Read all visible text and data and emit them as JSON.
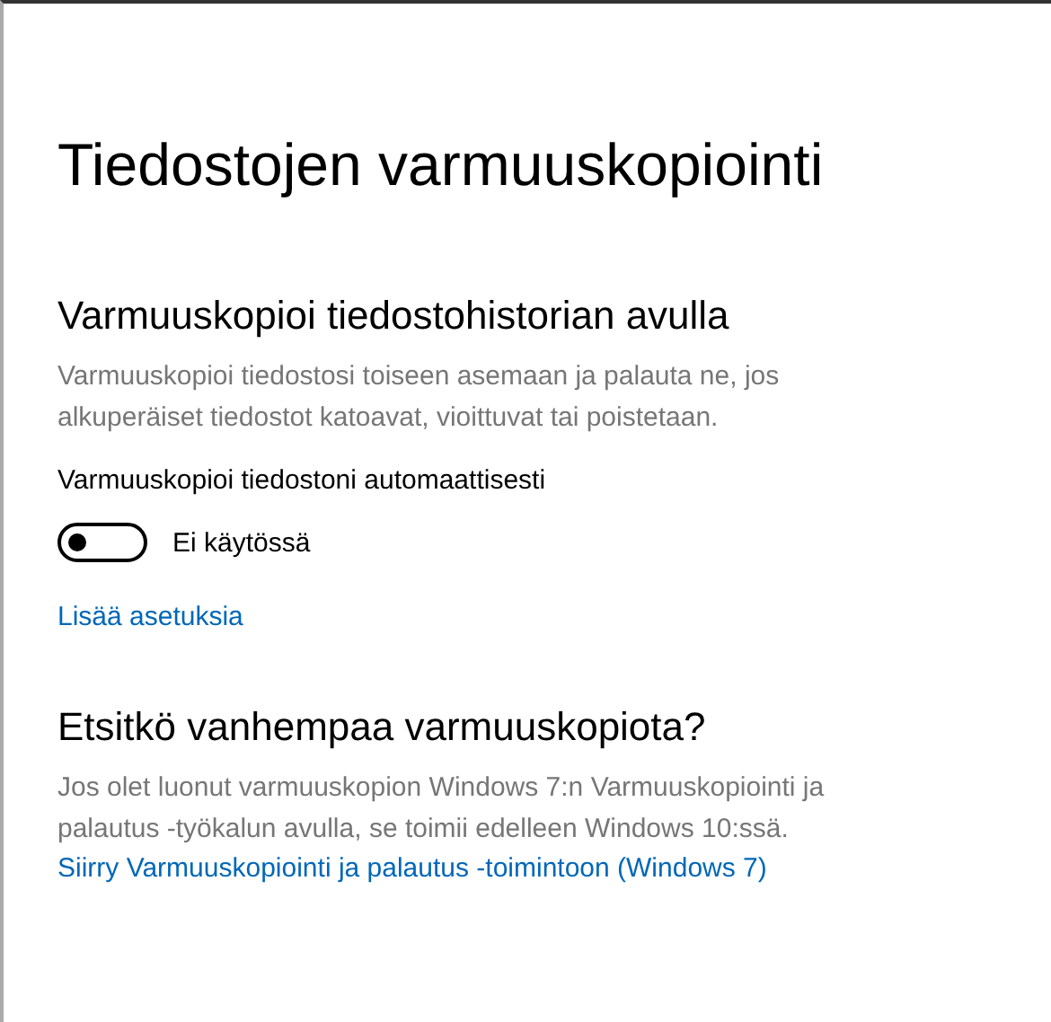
{
  "title": "Tiedostojen varmuuskopiointi",
  "sections": [
    {
      "heading": "Varmuuskopioi tiedostohistorian avulla",
      "description": "Varmuuskopioi tiedostosi toiseen asemaan ja palauta ne, jos alkuperäiset tiedostot katoavat, vioittuvat tai poistetaan.",
      "toggle": {
        "label": "Varmuuskopioi tiedostoni automaattisesti",
        "on": false,
        "state_text": "Ei käytössä"
      },
      "link": "Lisää asetuksia"
    },
    {
      "heading": "Etsitkö vanhempaa varmuuskopiota?",
      "description": "Jos olet luonut varmuuskopion Windows 7:n Varmuuskopiointi ja palautus -työkalun avulla, se toimii edelleen Windows 10:ssä.",
      "link": "Siirry Varmuuskopiointi ja palautus -toimintoon (Windows 7)"
    }
  ]
}
